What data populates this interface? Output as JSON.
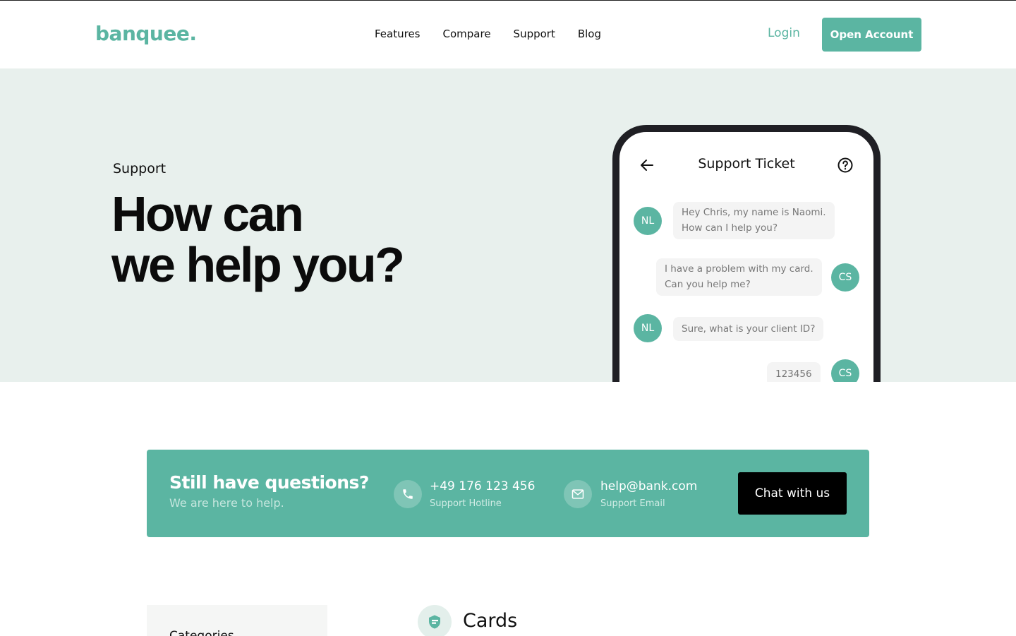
{
  "brand": {
    "logo": "banquee.",
    "accent": "#5bb5a2"
  },
  "nav": {
    "items": [
      "Features",
      "Compare",
      "Support",
      "Blog"
    ]
  },
  "header": {
    "login": "Login",
    "open_account": "Open Account"
  },
  "hero": {
    "kicker": "Support",
    "title_line1": "How can",
    "title_line2": "we help you?"
  },
  "phone": {
    "title": "Support Ticket",
    "back_icon": "arrow-left-icon",
    "help_icon": "question-circle-icon",
    "messages": [
      {
        "from": "NL",
        "side": "left",
        "line1": "Hey Chris, my name is Naomi.",
        "line2": "How can I help you?"
      },
      {
        "from": "CS",
        "side": "right",
        "line1": "I have a problem with my card.",
        "line2": "Can you help me?"
      },
      {
        "from": "NL",
        "side": "left",
        "line1": "Sure, what is your client ID?",
        "line2": ""
      },
      {
        "from": "CS",
        "side": "right",
        "line1": "123456",
        "line2": ""
      }
    ]
  },
  "cta": {
    "title": "Still have questions?",
    "subtitle": "We are here to help.",
    "phone": {
      "value": "+49 176 123 456",
      "label": "Support Hotline",
      "icon": "phone-icon"
    },
    "email": {
      "value": "help@bank.com",
      "label": "Support Email",
      "icon": "mail-icon"
    },
    "chat_button": "Chat with us"
  },
  "lower": {
    "categories_label": "Categories",
    "section_title": "Cards",
    "section_icon": "card-icon"
  }
}
